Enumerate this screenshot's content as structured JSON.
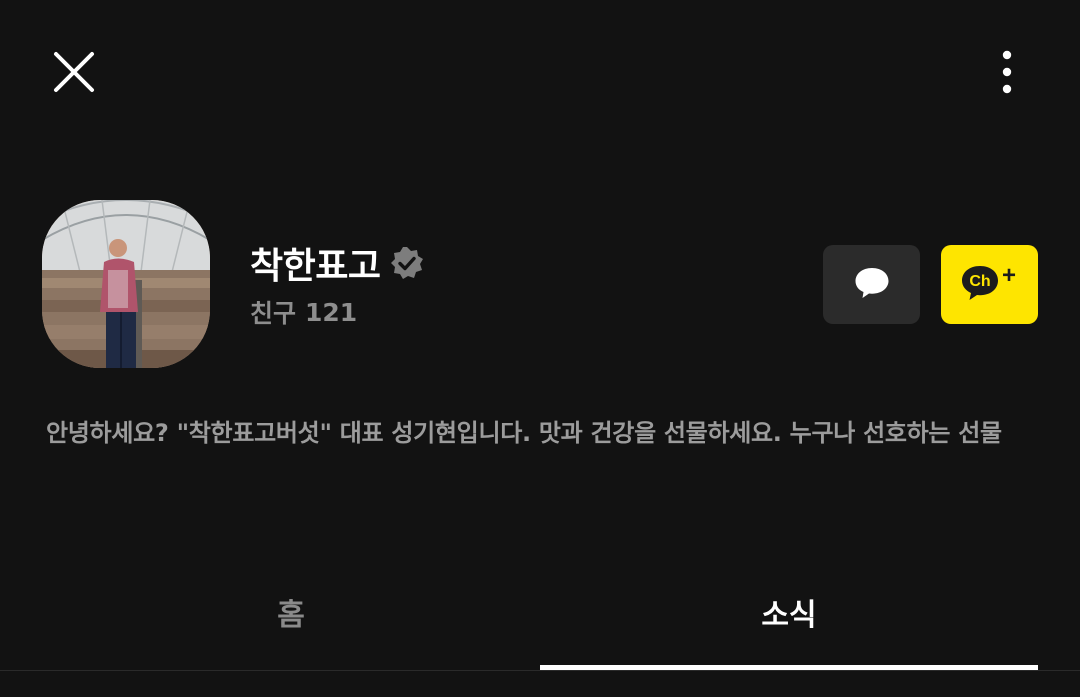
{
  "header": {
    "close_icon": "close-icon",
    "more_icon": "more-vertical-icon"
  },
  "profile": {
    "name": "착한표고",
    "verified_icon": "verified-check-icon",
    "friends_label": "친구",
    "friends_count": "121",
    "avatar": "avatar-photo"
  },
  "actions": {
    "chat_icon": "chat-bubble-icon",
    "channel_add_icon": "channel-add-icon",
    "channel_add_text": "Ch",
    "channel_add_plus": "+"
  },
  "description": "안녕하세요?  \"착한표고버섯\" 대표 성기현입니다. 맛과 건강을 선물하세요. 누구나 선호하는 선물",
  "tabs": [
    {
      "label": "홈",
      "active": false
    },
    {
      "label": "소식",
      "active": true
    }
  ],
  "colors": {
    "background": "#121212",
    "accent_yellow": "#fee500",
    "chat_button_bg": "#2b2b2b",
    "muted_text": "#8e8e8e"
  }
}
